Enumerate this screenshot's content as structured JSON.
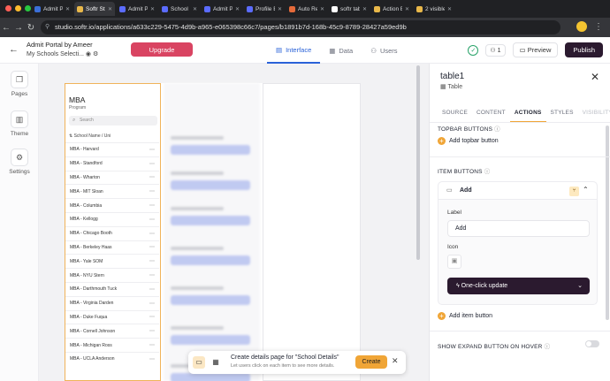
{
  "browser": {
    "tabs": [
      {
        "label": "Admit Pr",
        "color": "#3b6fd8",
        "active": false
      },
      {
        "label": "Softr Stu",
        "color": "#e9b84a",
        "active": true
      },
      {
        "label": "Admit Po",
        "color": "#5b6cff",
        "active": false
      },
      {
        "label": "School Pr",
        "color": "#5b6cff",
        "active": false
      },
      {
        "label": "Admit Pro",
        "color": "#5b6cff",
        "active": false
      },
      {
        "label": "Profile E",
        "color": "#5b6cff",
        "active": false
      },
      {
        "label": "Auto Refr",
        "color": "#e56a3a",
        "active": false
      },
      {
        "label": "softr tab",
        "color": "#ffffff",
        "active": false
      },
      {
        "label": "Action B",
        "color": "#e9b84a",
        "active": false
      },
      {
        "label": "2 visible",
        "color": "#e9b84a",
        "active": false
      }
    ],
    "url": "studio.softr.io/applications/a633c229-5475-4d9b-a965-e065398c66c7/pages/b1891b7d-168b-45c9-8789-28427a59ed9b"
  },
  "header": {
    "app_name": "Admit Portal by Ameer",
    "page_selector": "My Schools Selecti...",
    "upgrade_label": "Upgrade",
    "tabs": [
      {
        "label": "Interface",
        "active": true
      },
      {
        "label": "Data",
        "active": false
      },
      {
        "label": "Users",
        "active": false
      }
    ],
    "users_count": "1",
    "preview_label": "Preview",
    "publish_label": "Publish"
  },
  "rail": {
    "items": [
      {
        "label": "Pages"
      },
      {
        "label": "Theme"
      },
      {
        "label": "Settings"
      }
    ]
  },
  "canvas": {
    "list_title": "MBA",
    "list_subtitle": "Program",
    "search_placeholder": "Search",
    "sort_label": "School Name / Uni",
    "rows": [
      "MBA - Harvard",
      "MBA - Standford",
      "MBA - Wharton",
      "MBA - MIT Sloan",
      "MBA - Columbia",
      "MBA - Kellogg",
      "MBA - Chicago Booth",
      "MBA - Berkeley Haas",
      "MBA - Yale SOM",
      "MBA - NYU Stern",
      "MBA - Darthmouth Tuck",
      "MBA - Virginia Darden",
      "MBA - Duke Fuqua",
      "MBA - Cornell Johnson",
      "MBA - Michigan Ross",
      "MBA - UCLA Anderson"
    ]
  },
  "toast": {
    "title": "Create details page for \"School Details\"",
    "description": "Let users click on each item to see more details.",
    "create_label": "Create"
  },
  "panel": {
    "title": "table1",
    "type_label": "Table",
    "tabs": [
      {
        "label": "SOURCE",
        "state": "normal"
      },
      {
        "label": "CONTENT",
        "state": "normal"
      },
      {
        "label": "ACTIONS",
        "state": "active"
      },
      {
        "label": "STYLES",
        "state": "normal"
      },
      {
        "label": "VISIBILITY",
        "state": "muted"
      }
    ],
    "topbar_section": "TOPBAR BUTTONS",
    "add_topbar_label": "Add topbar button",
    "item_section": "ITEM BUTTONS",
    "button_card": {
      "name": "Add",
      "label_heading": "Label",
      "label_value": "Add",
      "icon_heading": "Icon",
      "action_value": "One-click update"
    },
    "add_item_label": "Add item button",
    "expand_label": "SHOW EXPAND BUTTON ON HOVER",
    "expand_enabled": false
  },
  "colors": {
    "accent": "#f0a536",
    "upgrade": "#d94462",
    "publish": "#2b1a2f",
    "interface_tab": "#2a62d8"
  }
}
